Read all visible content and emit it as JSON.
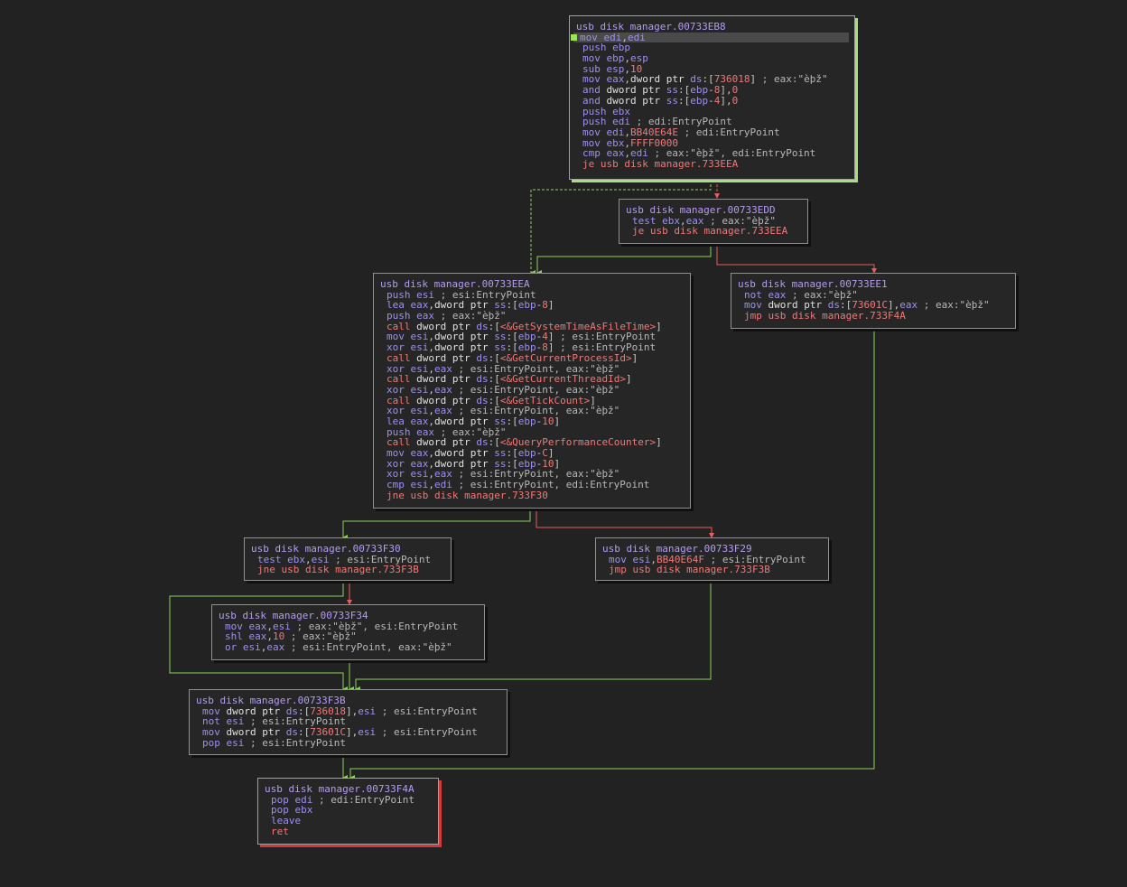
{
  "colors": {
    "background": "#222222",
    "edge_true": "#8cd15a",
    "edge_false": "#e85c5c",
    "entry_accent": "#a5e07a",
    "exit_accent": "#d23a3a",
    "mnemonic": "#9d90f0",
    "branch_mnemonic": "#f07878",
    "address": "#b49cf2"
  },
  "blocks": [
    {
      "id": "b0",
      "header": "usb disk manager.00733EB8",
      "lines": [
        "mov edi,edi",
        "push ebp",
        "mov ebp,esp",
        "sub esp,10",
        "mov eax,dword ptr ds:[736018] ; eax:\"èþž\"",
        "and dword ptr ss:[ebp-8],0",
        "and dword ptr ss:[ebp-4],0",
        "push ebx",
        "push edi ; edi:EntryPoint",
        "mov edi,BB40E64E ; edi:EntryPoint",
        "mov ebx,FFFF0000",
        "cmp eax,edi ; eax:\"èþž\", edi:EntryPoint",
        "je usb disk manager.733EEA"
      ]
    },
    {
      "id": "b1",
      "header": "usb disk manager.00733EDD",
      "lines": [
        "test ebx,eax ; eax:\"èþž\"",
        "je usb disk manager.733EEA"
      ]
    },
    {
      "id": "b2",
      "header": "usb disk manager.00733EEA",
      "lines": [
        "push esi ; esi:EntryPoint",
        "lea eax,dword ptr ss:[ebp-8]",
        "push eax ; eax:\"èþž\"",
        "call dword ptr ds:[<&GetSystemTimeAsFileTime>]",
        "mov esi,dword ptr ss:[ebp-4] ; esi:EntryPoint",
        "xor esi,dword ptr ss:[ebp-8] ; esi:EntryPoint",
        "call dword ptr ds:[<&GetCurrentProcessId>]",
        "xor esi,eax ; esi:EntryPoint, eax:\"èþž\"",
        "call dword ptr ds:[<&GetCurrentThreadId>]",
        "xor esi,eax ; esi:EntryPoint, eax:\"èþž\"",
        "call dword ptr ds:[<&GetTickCount>]",
        "xor esi,eax ; esi:EntryPoint, eax:\"èþž\"",
        "lea eax,dword ptr ss:[ebp-10]",
        "push eax ; eax:\"èþž\"",
        "call dword ptr ds:[<&QueryPerformanceCounter>]",
        "mov eax,dword ptr ss:[ebp-C]",
        "xor eax,dword ptr ss:[ebp-10]",
        "xor esi,eax ; esi:EntryPoint, eax:\"èþž\"",
        "cmp esi,edi ; esi:EntryPoint, edi:EntryPoint",
        "jne usb disk manager.733F30"
      ]
    },
    {
      "id": "b3",
      "header": "usb disk manager.00733EE1",
      "lines": [
        "not eax ; eax:\"èþž\"",
        "mov dword ptr ds:[73601C],eax ; eax:\"èþž\"",
        "jmp usb disk manager.733F4A"
      ]
    },
    {
      "id": "b4",
      "header": "usb disk manager.00733F30",
      "lines": [
        "test ebx,esi ; esi:EntryPoint",
        "jne usb disk manager.733F3B"
      ]
    },
    {
      "id": "b5",
      "header": "usb disk manager.00733F29",
      "lines": [
        "mov esi,BB40E64F ; esi:EntryPoint",
        "jmp usb disk manager.733F3B"
      ]
    },
    {
      "id": "b6",
      "header": "usb disk manager.00733F34",
      "lines": [
        "mov eax,esi ; eax:\"èþž\", esi:EntryPoint",
        "shl eax,10 ; eax:\"èþž\"",
        "or esi,eax ; esi:EntryPoint, eax:\"èþž\""
      ]
    },
    {
      "id": "b7",
      "header": "usb disk manager.00733F3B",
      "lines": [
        "mov dword ptr ds:[736018],esi ; esi:EntryPoint",
        "not esi ; esi:EntryPoint",
        "mov dword ptr ds:[73601C],esi ; esi:EntryPoint",
        "pop esi ; esi:EntryPoint"
      ]
    },
    {
      "id": "b8",
      "header": "usb disk manager.00733F4A",
      "lines": [
        "pop edi ; edi:EntryPoint",
        "pop ebx",
        "leave",
        "ret"
      ]
    }
  ]
}
